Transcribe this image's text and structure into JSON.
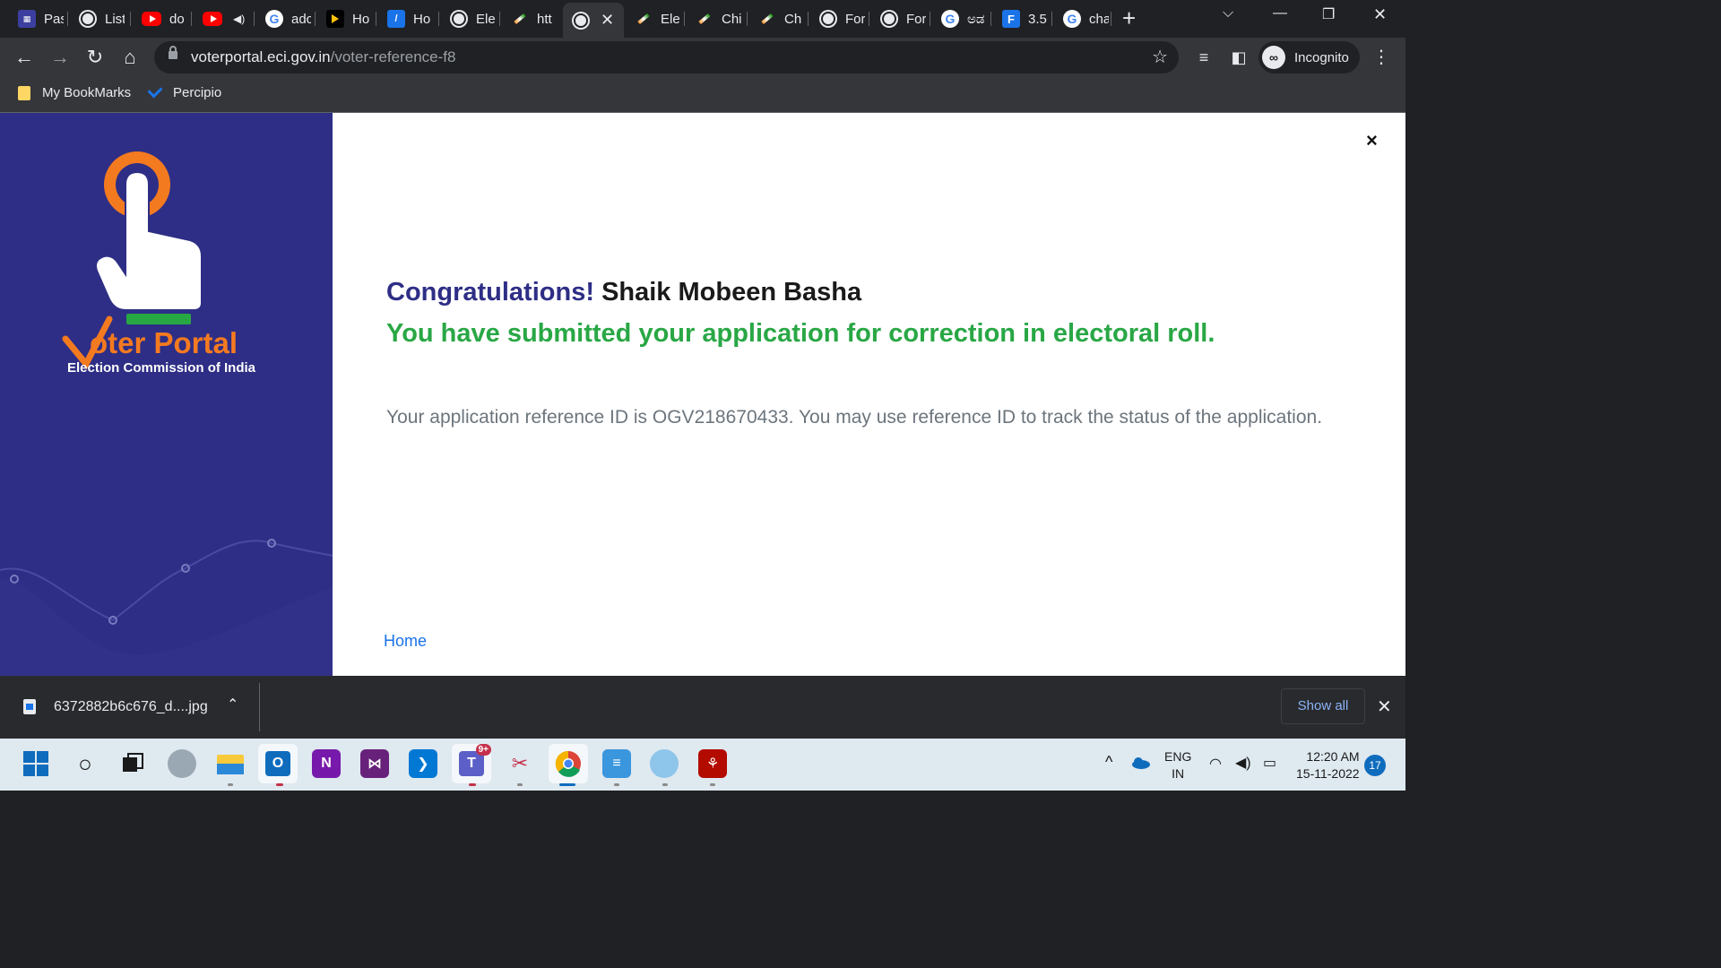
{
  "browser": {
    "tabs": [
      {
        "label": "Pas",
        "icon": "portal-icon",
        "active": false
      },
      {
        "label": "List",
        "icon": "globe-icon",
        "active": false
      },
      {
        "label": "do",
        "icon": "youtube-icon",
        "active": false
      },
      {
        "label": "",
        "icon": "youtube-icon",
        "active": false,
        "muted": true
      },
      {
        "label": "adc",
        "icon": "google-icon",
        "active": false
      },
      {
        "label": "Ho",
        "icon": "play-icon",
        "active": false
      },
      {
        "label": "Ho",
        "icon": "zip-icon",
        "active": false
      },
      {
        "label": "Ele",
        "icon": "globe-icon",
        "active": false
      },
      {
        "label": "htt",
        "icon": "eci-icon",
        "active": false
      },
      {
        "label": "",
        "icon": "globe-icon",
        "active": true
      },
      {
        "label": "Ele",
        "icon": "eci-icon",
        "active": false
      },
      {
        "label": "Chi",
        "icon": "eci-icon",
        "active": false
      },
      {
        "label": "Ch",
        "icon": "eci-icon",
        "active": false
      },
      {
        "label": "For",
        "icon": "globe-icon",
        "active": false
      },
      {
        "label": "For",
        "icon": "globe-icon",
        "active": false
      },
      {
        "label": "ಅಡ",
        "icon": "google-icon",
        "active": false
      },
      {
        "label": "3.5",
        "icon": "f-icon",
        "active": false
      },
      {
        "label": "cha",
        "icon": "google-icon",
        "active": false
      }
    ],
    "address": {
      "host": "voterportal.eci.gov.in",
      "path": "/voter-reference-f8"
    },
    "profile_label": "Incognito",
    "bookmarks": [
      {
        "label": "My BookMarks",
        "icon": "folder-icon"
      },
      {
        "label": "Percipio",
        "icon": "percipio-icon"
      }
    ]
  },
  "page": {
    "logo_title": "oter Portal",
    "logo_subtitle": "Election Commission of India",
    "congrats_prefix": "Congratulations!",
    "applicant_name": "Shaik Mobeen Basha",
    "success_message": "You have submitted your application for correction in electoral roll.",
    "reference_message": "Your application reference ID is OGV218670433. You may use reference ID to track the status of the application.",
    "home_link": "Home",
    "close_symbol": "×"
  },
  "downloads": {
    "file_name": "6372882b6c676_d....jpg",
    "show_all": "Show all"
  },
  "taskbar": {
    "apps": [
      "start",
      "search",
      "task-view",
      "edge",
      "file-explorer",
      "outlook",
      "onenote",
      "visual-studio",
      "vscode",
      "teams",
      "snipping-tool",
      "chrome",
      "notepad",
      "paint",
      "acrobat"
    ],
    "teams_badge": "9+",
    "language_line1": "ENG",
    "language_line2": "IN",
    "time": "12:20 AM",
    "date": "15-11-2022",
    "notifications": "17"
  },
  "colors": {
    "sidebar": "#2e2e86",
    "brand_orange": "#f47a20",
    "success_green": "#29a745",
    "link_blue": "#1a73e8"
  }
}
